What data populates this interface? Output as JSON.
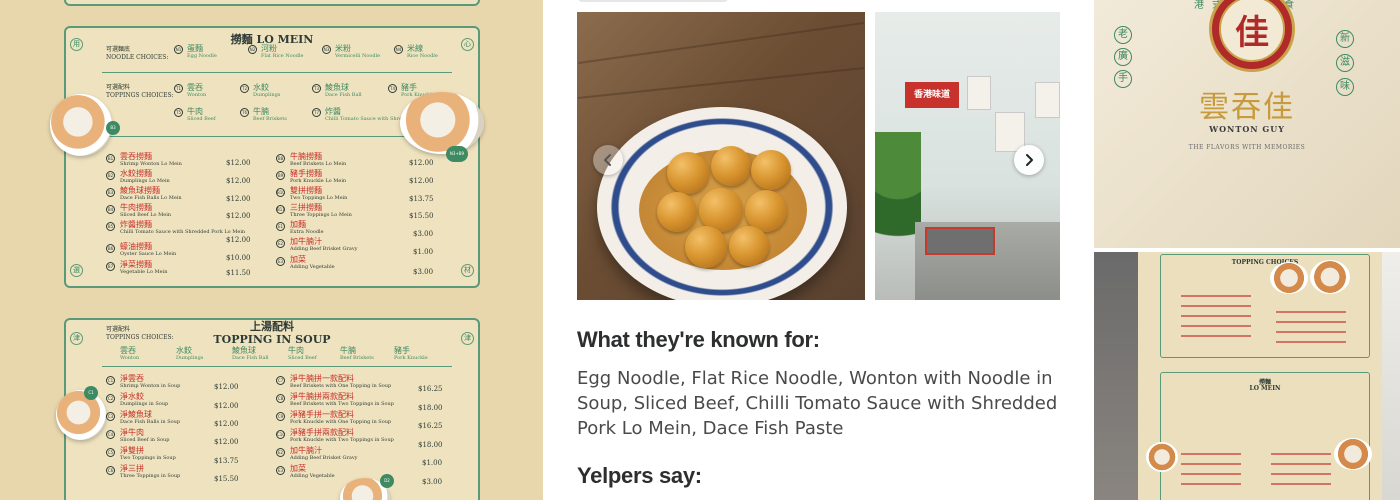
{
  "menu_photo": {
    "lomein_section": {
      "title": "撈麵 LO MEIN",
      "noodle_label_cn": "可選麵底",
      "noodle_label_en": "NOODLE CHOICES:",
      "noodle_choices": [
        {
          "code": "N1",
          "cn": "蛋麵",
          "en": "Egg Noodle"
        },
        {
          "code": "N2",
          "cn": "河粉",
          "en": "Flat Rice Noodle"
        },
        {
          "code": "N3",
          "cn": "米粉",
          "en": "Vermicelli Noodle"
        },
        {
          "code": "N4",
          "cn": "米線",
          "en": "Rice Noodle"
        }
      ],
      "topping_label_cn": "可選配料",
      "topping_label_en": "TOPPINGS CHOICES:",
      "topping_choices": [
        {
          "code": "T1",
          "cn": "雲吞",
          "en": "Wonton"
        },
        {
          "code": "T2",
          "cn": "水餃",
          "en": "Dumplings"
        },
        {
          "code": "T3",
          "cn": "鯪魚球",
          "en": "Dace Fish Ball"
        },
        {
          "code": "T4",
          "cn": "豬手",
          "en": "Pork Knuckle"
        },
        {
          "code": "T5",
          "cn": "牛肉",
          "en": "Sliced Beef"
        },
        {
          "code": "T6",
          "cn": "牛腩",
          "en": "Beef Briskets"
        },
        {
          "code": "T7",
          "cn": "炸醬",
          "en": "Chilli Tomato Sauce with Shredded Pork"
        }
      ],
      "items_left": [
        {
          "code": "B1",
          "cn": "雲吞撈麵",
          "en": "Shrimp Wonton Lo Mein",
          "price": "$12.00"
        },
        {
          "code": "B2",
          "cn": "水餃撈麵",
          "en": "Dumplings Lo Mein",
          "price": "$12.00"
        },
        {
          "code": "B3",
          "cn": "鯪魚球撈麵",
          "en": "Dace Fish Balls Lo Mein",
          "price": "$12.00"
        },
        {
          "code": "B4",
          "cn": "牛肉撈麵",
          "en": "Sliced Beef Lo Mein",
          "price": "$12.00"
        },
        {
          "code": "B5",
          "cn": "炸醬撈麵",
          "en": "Chilli Tomato Sauce with Shredded Pork Lo Mein",
          "price": "$12.00"
        },
        {
          "code": "B6",
          "cn": "蠔油撈麵",
          "en": "Oyster Sauce Lo Mein",
          "price": "$10.00"
        },
        {
          "code": "B7",
          "cn": "淨菜撈麵",
          "en": "Vegetable Lo Mein",
          "price": "$11.50"
        }
      ],
      "items_right": [
        {
          "code": "B8",
          "cn": "牛腩撈麵",
          "en": "Beef Briskets Lo Mein",
          "price": "$12.00"
        },
        {
          "code": "B9",
          "cn": "豬手撈麵",
          "en": "Pork Knuckle Lo Mein",
          "price": "$12.00"
        },
        {
          "code": "B10",
          "cn": "雙拼撈麵",
          "en": "Two Toppings Lo Mein",
          "price": "$13.75"
        },
        {
          "code": "B11",
          "cn": "三拼撈麵",
          "en": "Three Toppings Lo Mein",
          "price": "$15.50"
        },
        {
          "code": "E1",
          "cn": "加麵",
          "en": "Extra Noodle",
          "price": "$3.00"
        },
        {
          "code": "E2",
          "cn": "加牛腩汁",
          "en": "Adding Beef Brisket Gravy",
          "price": "$1.00"
        },
        {
          "code": "E3",
          "cn": "加菜",
          "en": "Adding Vegetable",
          "price": "$3.00"
        }
      ],
      "corner_chars": [
        "用",
        "心",
        "選",
        "材"
      ],
      "dish_badges": [
        "B3",
        "N3+B9"
      ]
    },
    "soup_section": {
      "title_cn": "上湯配料",
      "title_en": "TOPPING IN SOUP",
      "topping_label_cn": "可選配料",
      "topping_label_en": "TOPPINGS CHOICES:",
      "topping_choices": [
        {
          "code": "T1",
          "cn": "雲吞",
          "en": "Wonton"
        },
        {
          "code": "T2",
          "cn": "水餃",
          "en": "Dumplings"
        },
        {
          "code": "T3",
          "cn": "鯪魚球",
          "en": "Dace Fish Ball"
        },
        {
          "code": "T4",
          "cn": "牛肉",
          "en": "Sliced Beef"
        },
        {
          "code": "T5",
          "cn": "牛腩",
          "en": "Beef Briskets"
        },
        {
          "code": "T6",
          "cn": "豬手",
          "en": "Pork Knuckle"
        }
      ],
      "items_left": [
        {
          "code": "C1",
          "cn": "淨雲吞",
          "en": "Shrimp Wonton in Soup",
          "price": "$12.00"
        },
        {
          "code": "C2",
          "cn": "淨水餃",
          "en": "Dumplings in Soup",
          "price": "$12.00"
        },
        {
          "code": "C3",
          "cn": "淨鯪魚球",
          "en": "Dace Fish Balls in Soup",
          "price": "$12.00"
        },
        {
          "code": "C4",
          "cn": "淨牛肉",
          "en": "Sliced Beef in Soup",
          "price": "$12.00"
        },
        {
          "code": "C5",
          "cn": "淨雙拼",
          "en": "Two Toppings in Soup",
          "price": "$13.75"
        },
        {
          "code": "C6",
          "cn": "淨三拼",
          "en": "Three Toppings in Soup",
          "price": "$15.50"
        }
      ],
      "items_right": [
        {
          "code": "C7",
          "cn": "淨牛腩拼一款配料",
          "en": "Beef Briskets with One Topping in Soup",
          "price": "$16.25"
        },
        {
          "code": "C8",
          "cn": "淨牛腩拼兩款配料",
          "en": "Beef Briskets with Two Toppings in Soup",
          "price": "$18.00"
        },
        {
          "code": "C9",
          "cn": "淨豬手拼一款配料",
          "en": "Pork Knuckle with One Topping in Soup",
          "price": "$16.25"
        },
        {
          "code": "C10",
          "cn": "淨豬手拼兩款配料",
          "en": "Pork Knuckle with Two Toppings in Soup",
          "price": "$18.00"
        },
        {
          "code": "E2",
          "cn": "加牛腩汁",
          "en": "Adding Beef Brisket Gravy",
          "price": "$1.00"
        },
        {
          "code": "E3",
          "cn": "加菜",
          "en": "Adding Vegetable",
          "price": "$3.00"
        }
      ],
      "corner_chars": [
        "津",
        "津"
      ],
      "dish_badges": [
        "C1",
        "D2"
      ]
    }
  },
  "gallery": {
    "photo_b_sign": "香港味道",
    "prev_icon": "chevron-left-icon",
    "next_icon": "chevron-right-icon"
  },
  "known_for": {
    "heading": "What they're known for:",
    "text": "Egg Noodle, Flat Rice Noodle, Wonton with Noodle in Soup, Sliced Beef, Chilli Tomato Sauce with Shredded Pork Lo Mein, Dace Fish Paste"
  },
  "yelpers": {
    "heading": "Yelpers say:"
  },
  "logo_photo": {
    "logo_char": "佳",
    "top_text": "港式雲吞麵食",
    "name_cn": "雲吞佳",
    "name_en": "WONTON GUY",
    "tagline": "THE FLAVORS WITH MEMORIES",
    "left_chips": [
      "老",
      "廣",
      "手"
    ],
    "right_chips": [
      "新",
      "滋",
      "味"
    ]
  },
  "board_photo": {
    "top_title": "TOPPING CHOICES",
    "bottom_title_cn": "撈麵",
    "bottom_title_en": "LO MEIN"
  },
  "colors": {
    "menu_bg": "#e8d7ad",
    "menu_green": "#3e8a62",
    "menu_red": "#c62f2a",
    "heading_text": "#2d2e2f",
    "body_text": "#4a4a4a"
  }
}
